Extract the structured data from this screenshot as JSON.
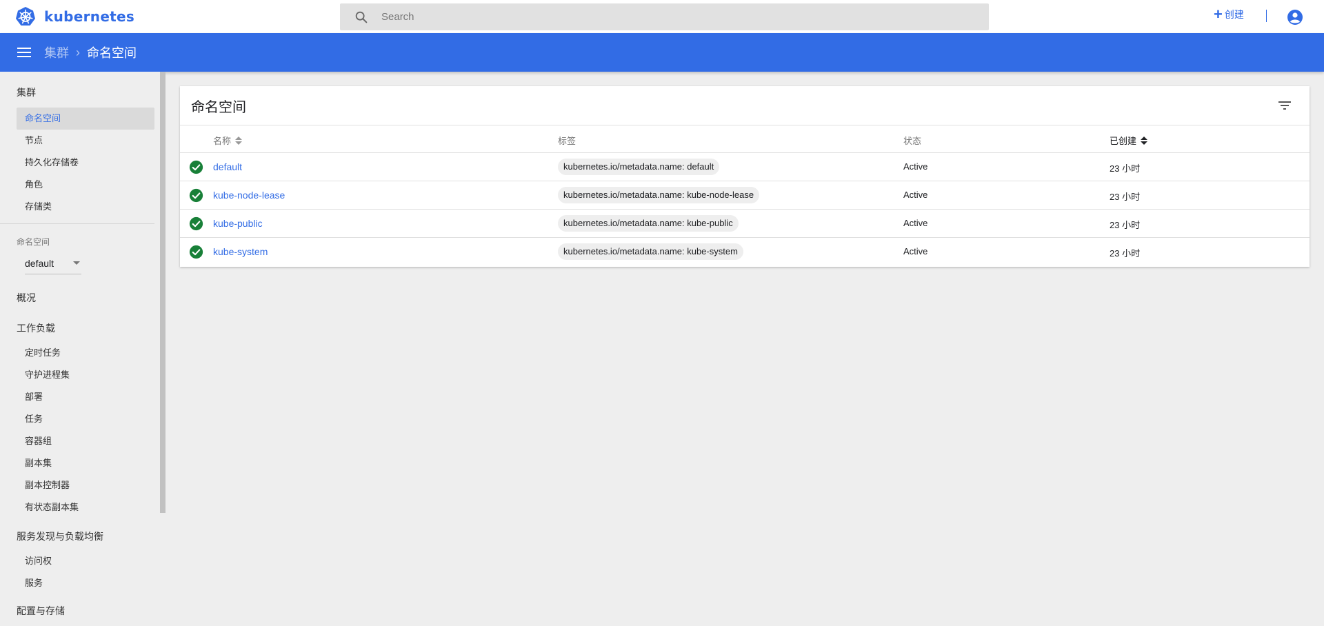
{
  "app": {
    "logo_text": "kubernetes"
  },
  "search": {
    "placeholder": "Search"
  },
  "header": {
    "create_label": "创建"
  },
  "breadcrumb": {
    "root": "集群",
    "current": "命名空间"
  },
  "sidebar": {
    "cluster_title": "集群",
    "cluster_items": [
      "命名空间",
      "节点",
      "持久化存储卷",
      "角色",
      "存储类"
    ],
    "active_item": "命名空间",
    "namespace_label": "命名空间",
    "namespace_selected": "default",
    "overview": "概况",
    "workloads_title": "工作负载",
    "workload_items": [
      "定时任务",
      "守护进程集",
      "部署",
      "任务",
      "容器组",
      "副本集",
      "副本控制器",
      "有状态副本集"
    ],
    "discovery_title": "服务发现与负载均衡",
    "discovery_items": [
      "访问权",
      "服务"
    ],
    "config_title": "配置与存储"
  },
  "card": {
    "title": "命名空间",
    "columns": {
      "name": "名称",
      "labels": "标签",
      "status": "状态",
      "created": "已创建"
    },
    "rows": [
      {
        "name": "default",
        "label": "kubernetes.io/metadata.name: default",
        "status": "Active",
        "created": "23 小时"
      },
      {
        "name": "kube-node-lease",
        "label": "kubernetes.io/metadata.name: kube-node-lease",
        "status": "Active",
        "created": "23 小时"
      },
      {
        "name": "kube-public",
        "label": "kubernetes.io/metadata.name: kube-public",
        "status": "Active",
        "created": "23 小时"
      },
      {
        "name": "kube-system",
        "label": "kubernetes.io/metadata.name: kube-system",
        "status": "Active",
        "created": "23 小时"
      }
    ]
  },
  "colors": {
    "brand": "#326ce5",
    "success": "#188038",
    "background": "#eeeeee"
  },
  "icons": {
    "logo": "kubernetes-wheel-icon",
    "search": "search-icon",
    "create": "plus-icon",
    "account": "account-circle-icon",
    "menu": "hamburger-menu-icon",
    "filter": "filter-icon",
    "status": "check-circle-icon"
  }
}
